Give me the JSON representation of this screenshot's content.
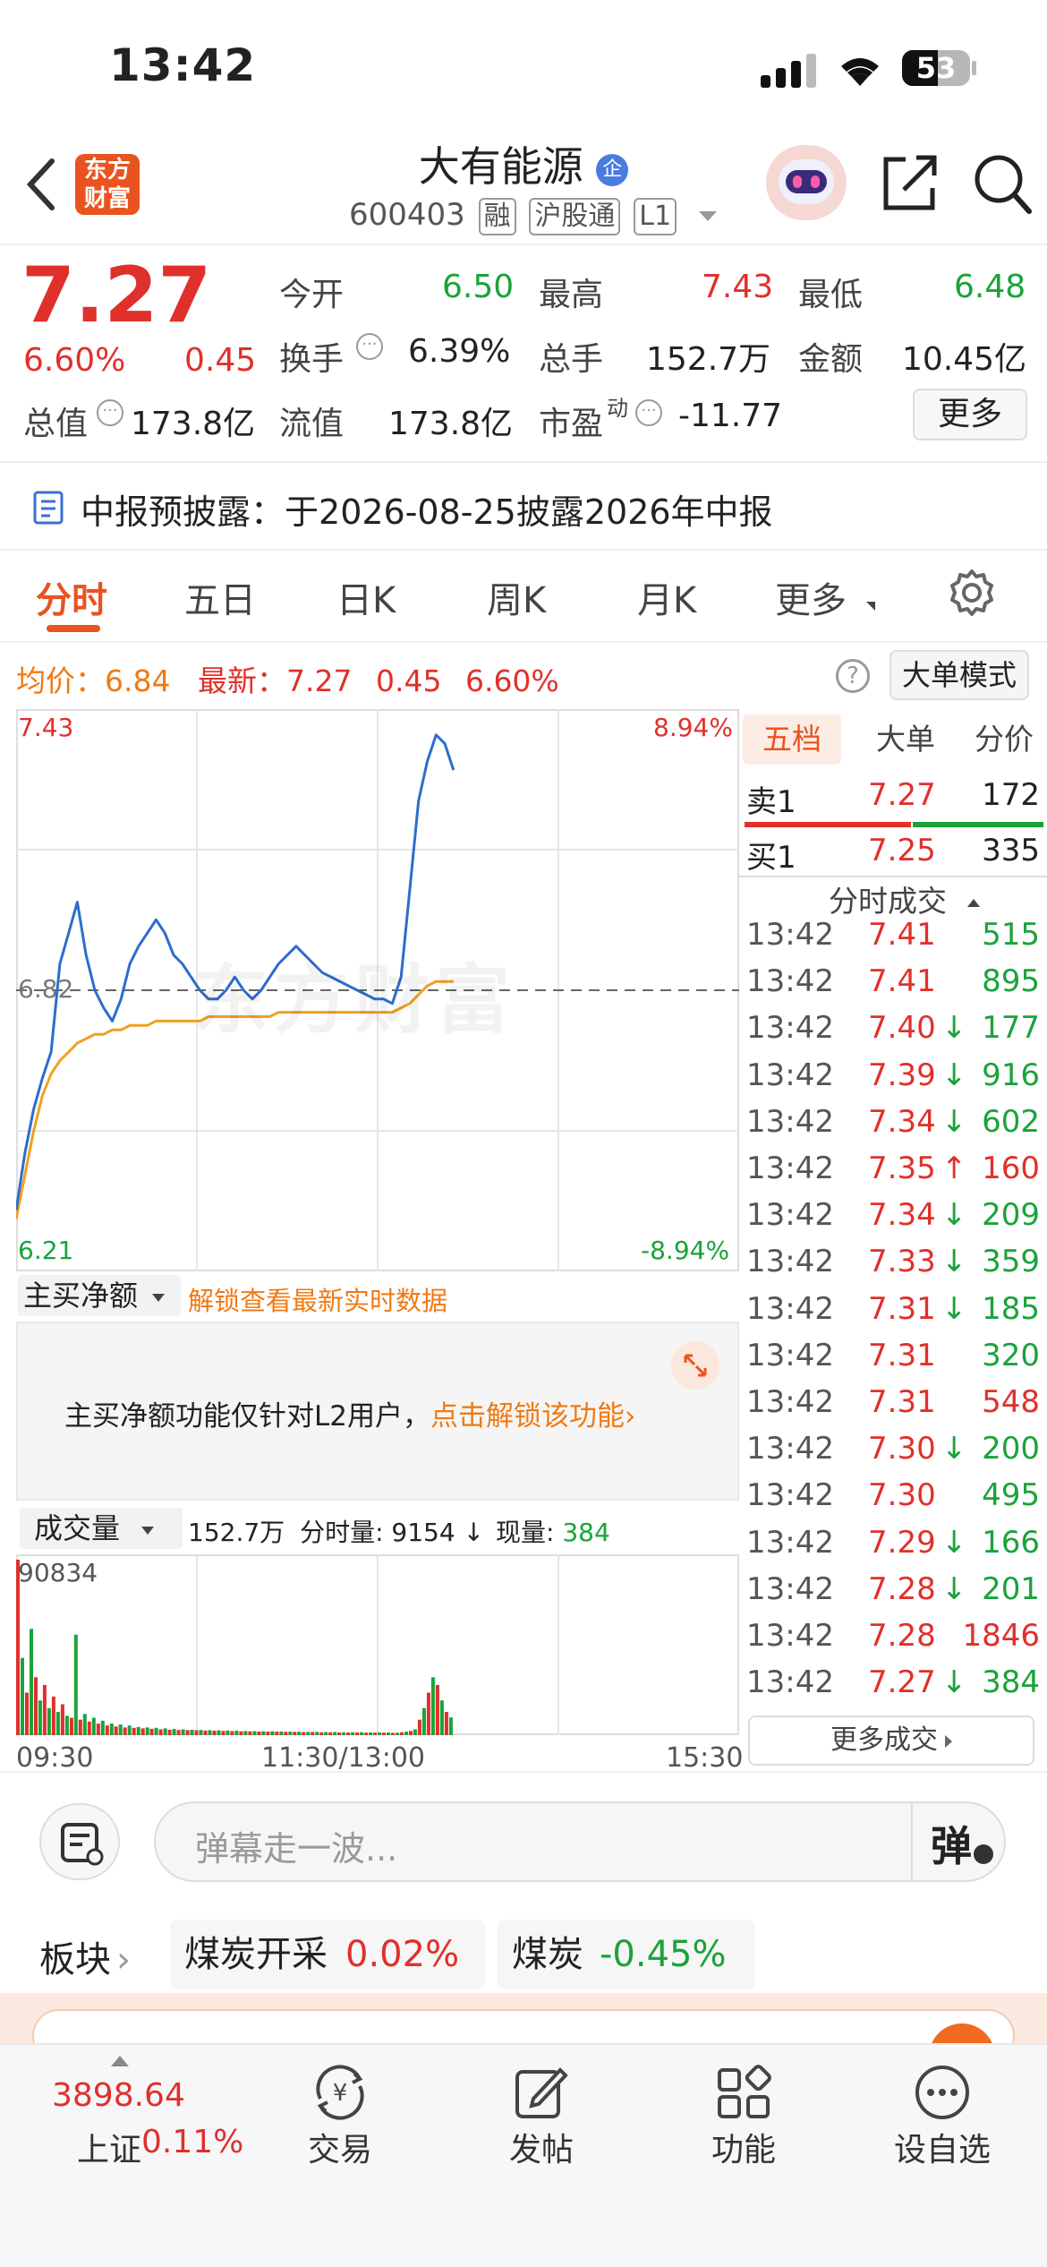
{
  "status": {
    "time": "13:42",
    "battery": "53"
  },
  "header": {
    "logo_line1": "东方",
    "logo_line2": "财富",
    "title": "大有能源",
    "title_badge": "企",
    "code": "600403",
    "tags": [
      "融",
      "沪股通",
      "L1"
    ]
  },
  "quote": {
    "price": "7.27",
    "change_pct": "6.60%",
    "change": "0.45",
    "fields": {
      "open_label": "今开",
      "open": "6.50",
      "high_label": "最高",
      "high": "7.43",
      "low_label": "最低",
      "low": "6.48",
      "turnover_label": "换手",
      "turnover": "6.39%",
      "volume_label": "总手",
      "volume": "152.7万",
      "amount_label": "金额",
      "amount": "10.45亿",
      "mcap_label": "总值",
      "mcap": "173.8亿",
      "float_label": "流值",
      "float": "173.8亿",
      "pe_label": "市盈",
      "pe_sup": "动",
      "pe": "-11.77",
      "more_label": "更多"
    }
  },
  "notice": {
    "label": "中报预披露：",
    "text": "于2026-08-25披露2026年中报"
  },
  "tabs": [
    "分时",
    "五日",
    "日K",
    "周K",
    "月K",
    "更多"
  ],
  "intraday": {
    "avg_label": "均价：",
    "avg": "6.84",
    "last_label": "最新：",
    "last": "7.27",
    "last_change": "0.45",
    "last_pct": "6.60%",
    "big_order_mode": "大单模式",
    "y_top": "7.43",
    "y_mid": "6.82",
    "y_bottom": "6.21",
    "pct_top": "8.94%",
    "pct_bottom": "-8.94%",
    "watermark": "东方财富"
  },
  "order_book": {
    "tabs": [
      "五档",
      "大单",
      "分价"
    ],
    "sell1_label": "卖1",
    "sell1_price": "7.27",
    "sell1_vol": "172",
    "buy1_label": "买1",
    "buy1_price": "7.25",
    "buy1_vol": "335",
    "ticks_title": "分时成交",
    "ticks": [
      {
        "t": "13:42",
        "p": "7.41",
        "d": "",
        "v": "515",
        "pc": "red",
        "vc": "green"
      },
      {
        "t": "13:42",
        "p": "7.41",
        "d": "",
        "v": "895",
        "pc": "red",
        "vc": "green"
      },
      {
        "t": "13:42",
        "p": "7.40",
        "d": "↓",
        "v": "177",
        "pc": "red",
        "vc": "green"
      },
      {
        "t": "13:42",
        "p": "7.39",
        "d": "↓",
        "v": "916",
        "pc": "red",
        "vc": "green"
      },
      {
        "t": "13:42",
        "p": "7.34",
        "d": "↓",
        "v": "602",
        "pc": "red",
        "vc": "green"
      },
      {
        "t": "13:42",
        "p": "7.35",
        "d": "↑",
        "v": "160",
        "pc": "red",
        "vc": "red"
      },
      {
        "t": "13:42",
        "p": "7.34",
        "d": "↓",
        "v": "209",
        "pc": "red",
        "vc": "green"
      },
      {
        "t": "13:42",
        "p": "7.33",
        "d": "↓",
        "v": "359",
        "pc": "red",
        "vc": "green"
      },
      {
        "t": "13:42",
        "p": "7.31",
        "d": "↓",
        "v": "185",
        "pc": "red",
        "vc": "green"
      },
      {
        "t": "13:42",
        "p": "7.31",
        "d": "",
        "v": "320",
        "pc": "red",
        "vc": "green"
      },
      {
        "t": "13:42",
        "p": "7.31",
        "d": "",
        "v": "548",
        "pc": "red",
        "vc": "red"
      },
      {
        "t": "13:42",
        "p": "7.30",
        "d": "↓",
        "v": "200",
        "pc": "red",
        "vc": "green"
      },
      {
        "t": "13:42",
        "p": "7.30",
        "d": "",
        "v": "495",
        "pc": "red",
        "vc": "green"
      },
      {
        "t": "13:42",
        "p": "7.29",
        "d": "↓",
        "v": "166",
        "pc": "red",
        "vc": "green"
      },
      {
        "t": "13:42",
        "p": "7.28",
        "d": "↓",
        "v": "201",
        "pc": "red",
        "vc": "green"
      },
      {
        "t": "13:42",
        "p": "7.28",
        "d": "",
        "v": "1846",
        "pc": "red",
        "vc": "red"
      },
      {
        "t": "13:42",
        "p": "7.27",
        "d": "↓",
        "v": "384",
        "pc": "red",
        "vc": "green"
      }
    ],
    "more_ticks": "更多成交"
  },
  "net_buy": {
    "selector": "主买净额",
    "unlock_link": "解锁查看最新实时数据",
    "info": "主买净额功能仅针对L2用户，",
    "info_link": "点击解锁该功能"
  },
  "volume": {
    "selector": "成交量",
    "total": "152.7万",
    "minute_label": "分时量:",
    "minute": "9154",
    "now_label": "现量:",
    "now": "384",
    "max": "90834",
    "x_start": "09:30",
    "x_mid": "11:30/13:00",
    "x_end": "15:30"
  },
  "comment": {
    "placeholder": "弹幕走一波...",
    "danmu_button": "弹"
  },
  "sectors": {
    "label": "板块",
    "items": [
      {
        "name": "煤炭开采",
        "pct": "0.02%",
        "color": "#e0302b"
      },
      {
        "name": "煤炭",
        "pct": "-0.45%",
        "color": "#1aa33a"
      }
    ]
  },
  "bottom_nav": {
    "index_value": "3898.64",
    "index_name": "上证",
    "index_pct": "0.11%",
    "items": [
      {
        "label": "交易",
        "icon": "yuan-exchange-icon"
      },
      {
        "label": "发帖",
        "icon": "edit-post-icon"
      },
      {
        "label": "功能",
        "icon": "apps-grid-icon"
      },
      {
        "label": "设自选",
        "icon": "more-dots-icon"
      }
    ]
  },
  "chart_data": {
    "type": "line",
    "title": "",
    "xlabel": "",
    "ylabel": "",
    "x_ticks": [
      "09:30",
      "11:30/13:00",
      "15:30"
    ],
    "ylim": [
      6.21,
      7.43
    ],
    "reference_price": 6.82,
    "series": [
      {
        "values": [
          6.32,
          6.45,
          6.55,
          6.62,
          6.68,
          6.88,
          6.95,
          7.02,
          6.9,
          6.82,
          6.78,
          6.75,
          6.8,
          6.88,
          6.92,
          6.95,
          6.98,
          6.95,
          6.9,
          6.88,
          6.85,
          6.82,
          6.8,
          6.8,
          6.82,
          6.85,
          6.82,
          6.8,
          6.82,
          6.85,
          6.88,
          6.9,
          6.92,
          6.9,
          6.88,
          6.86,
          6.85,
          6.84,
          6.83,
          6.82,
          6.81,
          6.8,
          6.8,
          6.79,
          6.85,
          7.05,
          7.25,
          7.34,
          7.4,
          7.38,
          7.32
        ],
        "color": "#2c6dcc"
      },
      {
        "values": [
          6.3,
          6.4,
          6.5,
          6.58,
          6.63,
          6.66,
          6.68,
          6.7,
          6.71,
          6.72,
          6.72,
          6.73,
          6.73,
          6.74,
          6.74,
          6.74,
          6.75,
          6.75,
          6.75,
          6.75,
          6.75,
          6.75,
          6.76,
          6.76,
          6.76,
          6.76,
          6.76,
          6.76,
          6.76,
          6.76,
          6.77,
          6.77,
          6.77,
          6.77,
          6.77,
          6.77,
          6.77,
          6.77,
          6.77,
          6.77,
          6.77,
          6.77,
          6.77,
          6.77,
          6.78,
          6.79,
          6.81,
          6.83,
          6.84,
          6.84,
          6.84
        ],
        "color": "#f0a020"
      }
    ],
    "volume_series": {
      "ylim": [
        0,
        90834
      ],
      "values": [
        90834,
        40000,
        22000,
        55000,
        30000,
        18000,
        26000,
        14000,
        20000,
        12000,
        16000,
        10000,
        9000,
        52000,
        8000,
        11000,
        7000,
        9000,
        6000,
        7500,
        5000,
        6000,
        4500,
        5500,
        4000,
        5000,
        3800,
        4200,
        3500,
        4000,
        3300,
        3800,
        3000,
        3500,
        2800,
        3200,
        2700,
        3000,
        2600,
        2800,
        2500,
        2700,
        2400,
        2600,
        2300,
        2500,
        2200,
        2400,
        2100,
        2300,
        2000,
        2200,
        2000,
        2100,
        1900,
        2000,
        1800,
        2000,
        1800,
        1900,
        1700,
        1800,
        1700,
        1800,
        1600,
        1700,
        1600,
        1700,
        1500,
        1600,
        1500,
        1600,
        1400,
        1500,
        1400,
        1500,
        1400,
        1500,
        1300,
        1400,
        1300,
        1400,
        1300,
        1400,
        1200,
        1300,
        1500,
        1800,
        2200,
        3000,
        8000,
        14000,
        22000,
        30000,
        26000,
        18000,
        12000,
        9154
      ],
      "colors": "alternating"
    }
  }
}
